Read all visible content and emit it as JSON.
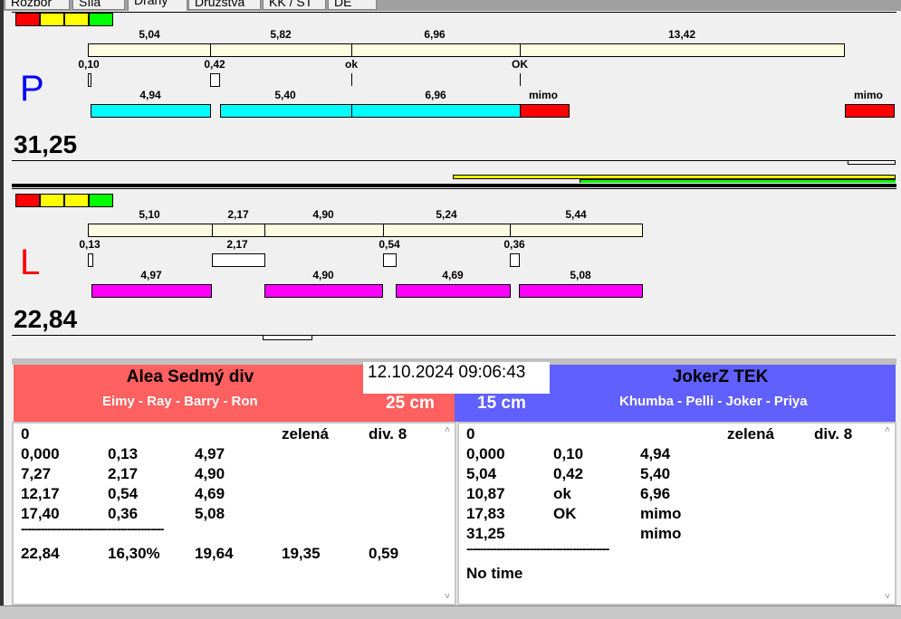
{
  "tabs": [
    "Rozbor",
    "Síla",
    "Dráhy",
    "Družstva",
    "KK / ST",
    "DE"
  ],
  "lamps": [
    "#ff0000",
    "#ffff00",
    "#ffff00",
    "#00ff00"
  ],
  "right_lane": {
    "side": "P",
    "total": "31,25",
    "top_labels": [
      "5,04",
      "5,82",
      "6,96",
      "13,42"
    ],
    "mid_labels": [
      "0,10",
      "0,42",
      "ok",
      "OK"
    ],
    "bottom_labels": [
      "4,94",
      "5,40",
      "6,96",
      "mimo",
      "mimo"
    ]
  },
  "left_lane": {
    "side": "L",
    "total": "22,84",
    "top_labels": [
      "5,10",
      "2,17",
      "4,90",
      "5,24",
      "5,44"
    ],
    "mid_labels": [
      "0,13",
      "2,17",
      "0,54",
      "0,36"
    ],
    "bottom_labels": [
      "4,97",
      "4,90",
      "4,69",
      "5,08"
    ]
  },
  "datetime": "12.10.2024 09:06:43",
  "team_left": {
    "name": "Alea Sedmý div",
    "members": "Eimy - Ray - Barry - Ron",
    "distance": "25 cm",
    "color": "#ff6060",
    "header": [
      "0",
      "zelená",
      "div. 8"
    ],
    "rows": [
      [
        "0,000",
        "0,13",
        "4,97"
      ],
      [
        "7,27",
        "2,17",
        "4,90"
      ],
      [
        "12,17",
        "0,54",
        "4,69"
      ],
      [
        "17,40",
        "0,36",
        "5,08"
      ]
    ],
    "separator": "-------------------------------------------",
    "summary": [
      "22,84",
      "16,30%",
      "19,64",
      "19,35",
      "0,59"
    ]
  },
  "team_right": {
    "name": "JokerZ TEK",
    "members": "Khumba - Pelli - Joker - Priya",
    "distance": "15 cm",
    "color": "#6060ff",
    "header": [
      "0",
      "zelená",
      "div. 8"
    ],
    "rows": [
      [
        "0,000",
        "0,10",
        "4,94"
      ],
      [
        "5,04",
        "0,42",
        "5,40"
      ],
      [
        "10,87",
        "ok",
        "6,96"
      ],
      [
        "17,83",
        "OK",
        "mimo"
      ],
      [
        "31,25",
        "",
        "mimo"
      ]
    ],
    "separator": "-------------------------------------------",
    "summary_text": "No time"
  }
}
